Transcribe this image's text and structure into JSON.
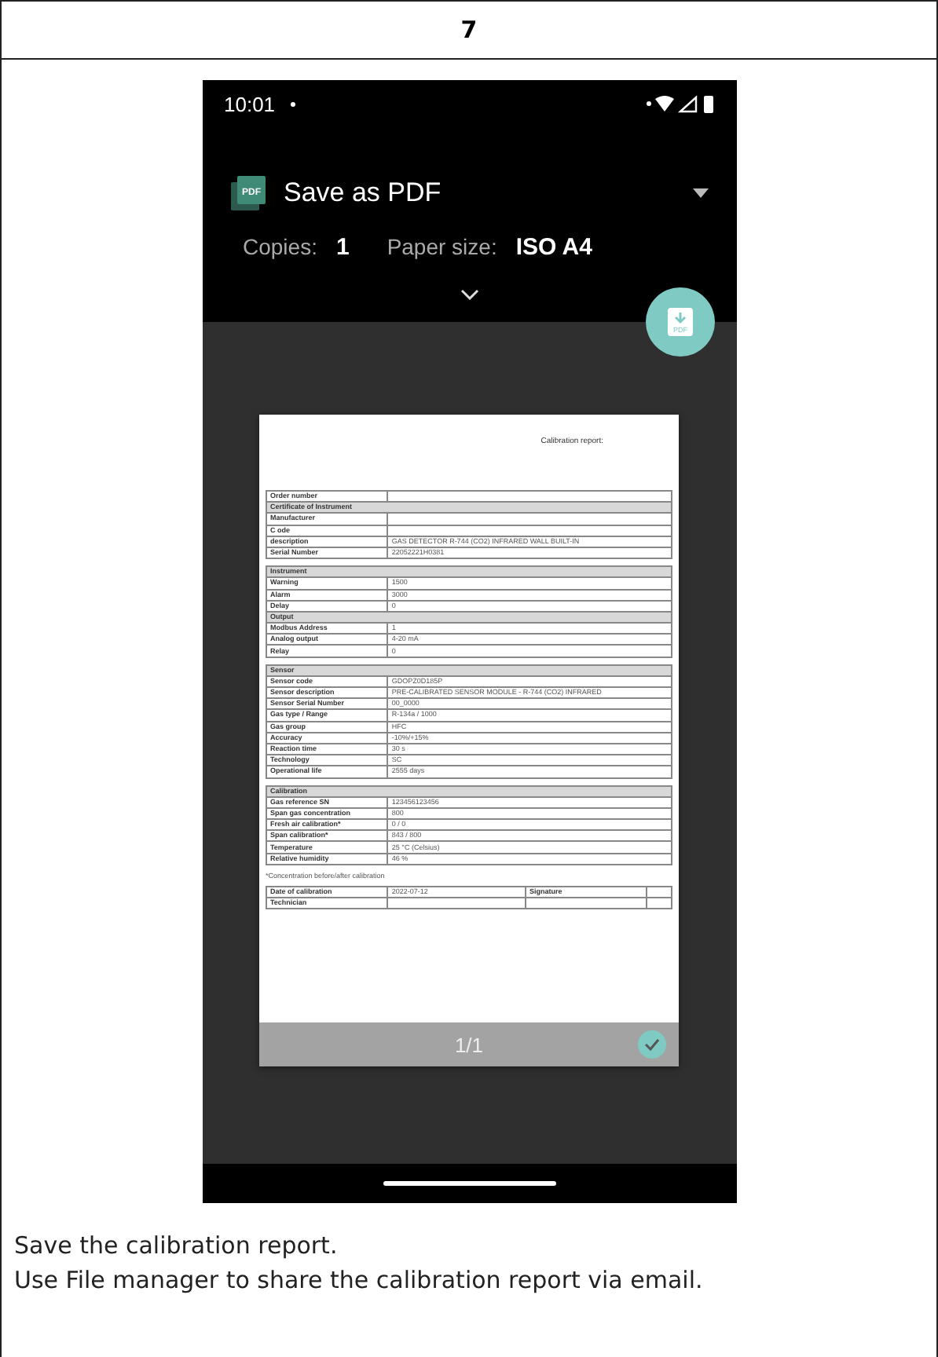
{
  "step": {
    "number": "7"
  },
  "phone": {
    "status_bar": {
      "time": "10:01"
    },
    "print_header": {
      "icon_text": "PDF",
      "fab_text": "PDF",
      "printer": "Save as PDF",
      "copies_label": "Copies:",
      "copies": "1",
      "paper_size_label": "Paper size:",
      "paper_size": "ISO A4"
    },
    "preview": {
      "report_title": "Calibration report:",
      "tables": [
        {
          "rows": [
            {
              "kind": "row",
              "label": "Order number"
            },
            {
              "kind": "header",
              "label": "Certificate of Instrument"
            },
            {
              "kind": "row",
              "label": "Manufacturer"
            },
            {
              "kind": "row",
              "label": "C ode"
            },
            {
              "kind": "row",
              "label": "description",
              "value": "GAS DETECTOR R-744 (CO2) INFRARED WALL BUILT-IN"
            },
            {
              "kind": "row",
              "label": "Serial Number",
              "value": "22052221H0381"
            }
          ]
        },
        {
          "rows": [
            {
              "kind": "header",
              "label": "Instrument"
            },
            {
              "kind": "row",
              "label": "Warning",
              "value": "1500"
            },
            {
              "kind": "row",
              "label": "Alarm",
              "value": "3000"
            },
            {
              "kind": "row",
              "label": "Delay",
              "value": "0"
            },
            {
              "kind": "header",
              "label": "Output"
            },
            {
              "kind": "row",
              "label": "Modbus Address",
              "value": "1"
            },
            {
              "kind": "row",
              "label": "Analog output",
              "value": "4-20 mA"
            },
            {
              "kind": "row",
              "label": "Relay",
              "value": "0"
            }
          ]
        },
        {
          "rows": [
            {
              "kind": "header",
              "label": "Sensor"
            },
            {
              "kind": "row",
              "label": "Sensor code",
              "value": "GDOPZ0D185P"
            },
            {
              "kind": "row",
              "label": "Sensor description",
              "value": "PRE-CALIBRATED SENSOR MODULE - R-744 (CO2) INFRARED"
            },
            {
              "kind": "row",
              "label": "Sensor Serial Number",
              "value": "00_0000"
            },
            {
              "kind": "row",
              "label": "Gas type / Range",
              "value": "R-134a / 1000"
            },
            {
              "kind": "row",
              "label": "Gas group",
              "value": "HFC"
            },
            {
              "kind": "row",
              "label": "Accuracy",
              "value": "-10%/+15%"
            },
            {
              "kind": "row",
              "label": "Reaction time",
              "value": "30 s"
            },
            {
              "kind": "row",
              "label": "Technology",
              "value": "SC"
            },
            {
              "kind": "row",
              "label": "Operational life",
              "value": "2555 days"
            }
          ]
        },
        {
          "rows": [
            {
              "kind": "header",
              "label": "Calibration"
            },
            {
              "kind": "row",
              "label": "Gas reference SN",
              "value": "123456123456"
            },
            {
              "kind": "row",
              "label": "Span gas concentration",
              "value": "800"
            },
            {
              "kind": "row",
              "label": "Fresh air calibration*",
              "value": "0 / 0"
            },
            {
              "kind": "row",
              "label": "Span calibration*",
              "value": "843 / 800"
            },
            {
              "kind": "row",
              "label": "Temperature",
              "value": "25 °C (Celsius)"
            },
            {
              "kind": "row",
              "label": "Relative humidity",
              "value": "46 %"
            }
          ]
        }
      ],
      "footnote": "*Concentration before/after calibration",
      "signature_table": [
        {
          "label": "Date of calibration",
          "value": "2022-07-12",
          "label_2": "Signature"
        },
        {
          "label": "Technician"
        }
      ],
      "page_indicator": "1/1",
      "page_selected": true
    }
  },
  "instructions": [
    "Save the calibration report.",
    "Use File manager to share the calibration report via email."
  ]
}
